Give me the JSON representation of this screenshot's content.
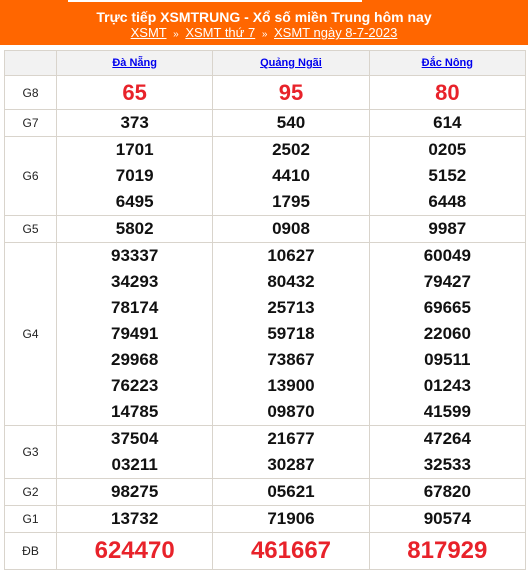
{
  "banner": {
    "title": "Trực tiếp XSMTRUNG - Xổ số miền Trung hôm nay",
    "breadcrumb": [
      {
        "label": "XSMT"
      },
      {
        "label": "XSMT thứ 7"
      },
      {
        "label": "XSMT ngày 8-7-2023"
      }
    ],
    "separator": "»",
    "background_color": "#ff6600"
  },
  "table": {
    "provinces": [
      "Đà Nẵng",
      "Quảng Ngãi",
      "Đắc Nông"
    ],
    "rows": [
      {
        "label": "G8",
        "values": [
          [
            "65"
          ],
          [
            "95"
          ],
          [
            "80"
          ]
        ]
      },
      {
        "label": "G7",
        "values": [
          [
            "373"
          ],
          [
            "540"
          ],
          [
            "614"
          ]
        ]
      },
      {
        "label": "G6",
        "values": [
          [
            "1701",
            "7019",
            "6495"
          ],
          [
            "2502",
            "4410",
            "1795"
          ],
          [
            "0205",
            "5152",
            "6448"
          ]
        ]
      },
      {
        "label": "G5",
        "values": [
          [
            "5802"
          ],
          [
            "0908"
          ],
          [
            "9987"
          ]
        ]
      },
      {
        "label": "G4",
        "values": [
          [
            "93337",
            "34293",
            "78174",
            "79491",
            "29968",
            "76223",
            "14785"
          ],
          [
            "10627",
            "80432",
            "25713",
            "59718",
            "73867",
            "13900",
            "09870"
          ],
          [
            "60049",
            "79427",
            "69665",
            "22060",
            "09511",
            "01243",
            "41599"
          ]
        ]
      },
      {
        "label": "G3",
        "values": [
          [
            "37504",
            "03211"
          ],
          [
            "21677",
            "30287"
          ],
          [
            "47264",
            "32533"
          ]
        ]
      },
      {
        "label": "G2",
        "values": [
          [
            "98275"
          ],
          [
            "05621"
          ],
          [
            "67820"
          ]
        ]
      },
      {
        "label": "G1",
        "values": [
          [
            "13732"
          ],
          [
            "71906"
          ],
          [
            "90574"
          ]
        ]
      },
      {
        "label": "ĐB",
        "values": [
          [
            "624470"
          ],
          [
            "461667"
          ],
          [
            "817929"
          ]
        ]
      }
    ],
    "highlight_color": "#e8222a",
    "link_color": "#0000ee"
  }
}
